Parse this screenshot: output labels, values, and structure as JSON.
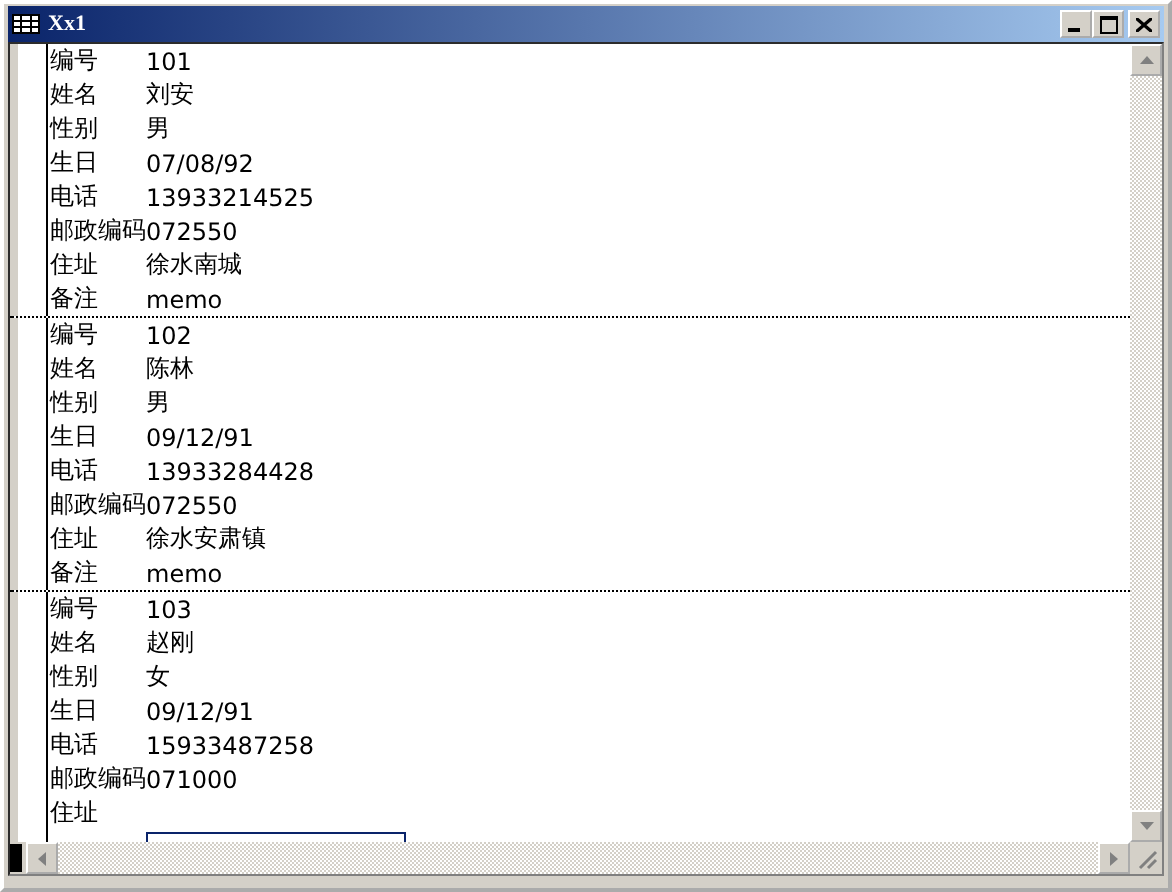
{
  "window": {
    "title": "Xx1"
  },
  "records": [
    {
      "fields": [
        {
          "label": "编号",
          "value": "101",
          "focused": false
        },
        {
          "label": "姓名",
          "value": "刘安",
          "focused": false
        },
        {
          "label": "性别",
          "value": "男",
          "focused": false
        },
        {
          "label": "生日",
          "value": "07/08/92",
          "focused": false
        },
        {
          "label": "电话",
          "value": "13933214525",
          "focused": false
        },
        {
          "label": "邮政编码",
          "value": "072550",
          "focused": false
        },
        {
          "label": "住址",
          "value": "徐水南城",
          "focused": false
        },
        {
          "label": "备注",
          "value": "memo",
          "focused": false
        }
      ]
    },
    {
      "fields": [
        {
          "label": "编号",
          "value": "102",
          "focused": false
        },
        {
          "label": "姓名",
          "value": "陈林",
          "focused": false
        },
        {
          "label": "性别",
          "value": "男",
          "focused": false
        },
        {
          "label": "生日",
          "value": "09/12/91",
          "focused": false
        },
        {
          "label": "电话",
          "value": "13933284428",
          "focused": false
        },
        {
          "label": "邮政编码",
          "value": "072550",
          "focused": false
        },
        {
          "label": "住址",
          "value": "徐水安肃镇",
          "focused": false
        },
        {
          "label": "备注",
          "value": "memo",
          "focused": false
        }
      ]
    },
    {
      "fields": [
        {
          "label": "编号",
          "value": "103",
          "focused": false
        },
        {
          "label": "姓名",
          "value": "赵刚",
          "focused": false
        },
        {
          "label": "性别",
          "value": "女",
          "focused": false
        },
        {
          "label": "生日",
          "value": "09/12/91",
          "focused": false
        },
        {
          "label": "电话",
          "value": "15933487258",
          "focused": false
        },
        {
          "label": "邮政编码",
          "value": "071000",
          "focused": false
        },
        {
          "label": "住址",
          "focused": false
        },
        {
          "focused": true
        }
      ]
    }
  ]
}
